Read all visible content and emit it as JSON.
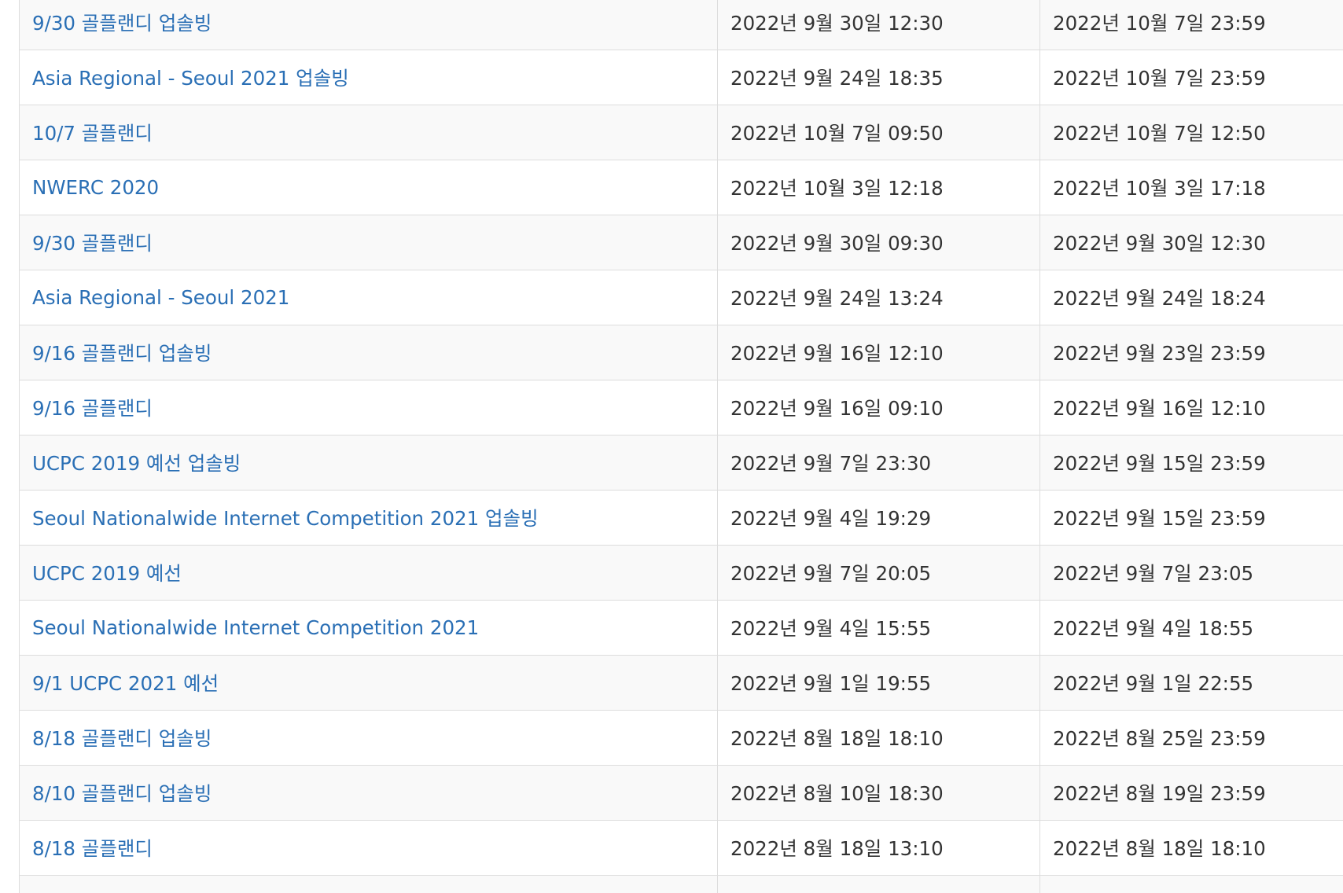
{
  "contests": [
    {
      "name": "9/30 골플랜디 업솔빙",
      "start": "2022년 9월 30일 12:30",
      "end": "2022년 10월 7일 23:59"
    },
    {
      "name": "Asia Regional - Seoul 2021 업솔빙",
      "start": "2022년 9월 24일 18:35",
      "end": "2022년 10월 7일 23:59"
    },
    {
      "name": "10/7 골플랜디",
      "start": "2022년 10월 7일 09:50",
      "end": "2022년 10월 7일 12:50"
    },
    {
      "name": "NWERC 2020",
      "start": "2022년 10월 3일 12:18",
      "end": "2022년 10월 3일 17:18"
    },
    {
      "name": "9/30 골플랜디",
      "start": "2022년 9월 30일 09:30",
      "end": "2022년 9월 30일 12:30"
    },
    {
      "name": "Asia Regional - Seoul 2021",
      "start": "2022년 9월 24일 13:24",
      "end": "2022년 9월 24일 18:24"
    },
    {
      "name": "9/16 골플랜디 업솔빙",
      "start": "2022년 9월 16일 12:10",
      "end": "2022년 9월 23일 23:59"
    },
    {
      "name": "9/16 골플랜디",
      "start": "2022년 9월 16일 09:10",
      "end": "2022년 9월 16일 12:10"
    },
    {
      "name": "UCPC 2019 예선 업솔빙",
      "start": "2022년 9월 7일 23:30",
      "end": "2022년 9월 15일 23:59"
    },
    {
      "name": "Seoul Nationalwide Internet Competition 2021 업솔빙",
      "start": "2022년 9월 4일 19:29",
      "end": "2022년 9월 15일 23:59"
    },
    {
      "name": "UCPC 2019 예선",
      "start": "2022년 9월 7일 20:05",
      "end": "2022년 9월 7일 23:05"
    },
    {
      "name": "Seoul Nationalwide Internet Competition 2021",
      "start": "2022년 9월 4일 15:55",
      "end": "2022년 9월 4일 18:55"
    },
    {
      "name": "9/1 UCPC 2021 예선",
      "start": "2022년 9월 1일 19:55",
      "end": "2022년 9월 1일 22:55"
    },
    {
      "name": "8/18 골플랜디 업솔빙",
      "start": "2022년 8월 18일 18:10",
      "end": "2022년 8월 25일 23:59"
    },
    {
      "name": "8/10 골플랜디 업솔빙",
      "start": "2022년 8월 10일 18:30",
      "end": "2022년 8월 19일 23:59"
    },
    {
      "name": "8/18 골플랜디",
      "start": "2022년 8월 18일 13:10",
      "end": "2022년 8월 18일 18:10"
    }
  ],
  "colors": {
    "link": "#2a6fb5",
    "text": "#333333",
    "border": "#dddddd",
    "stripe": "#f9f9f9"
  }
}
